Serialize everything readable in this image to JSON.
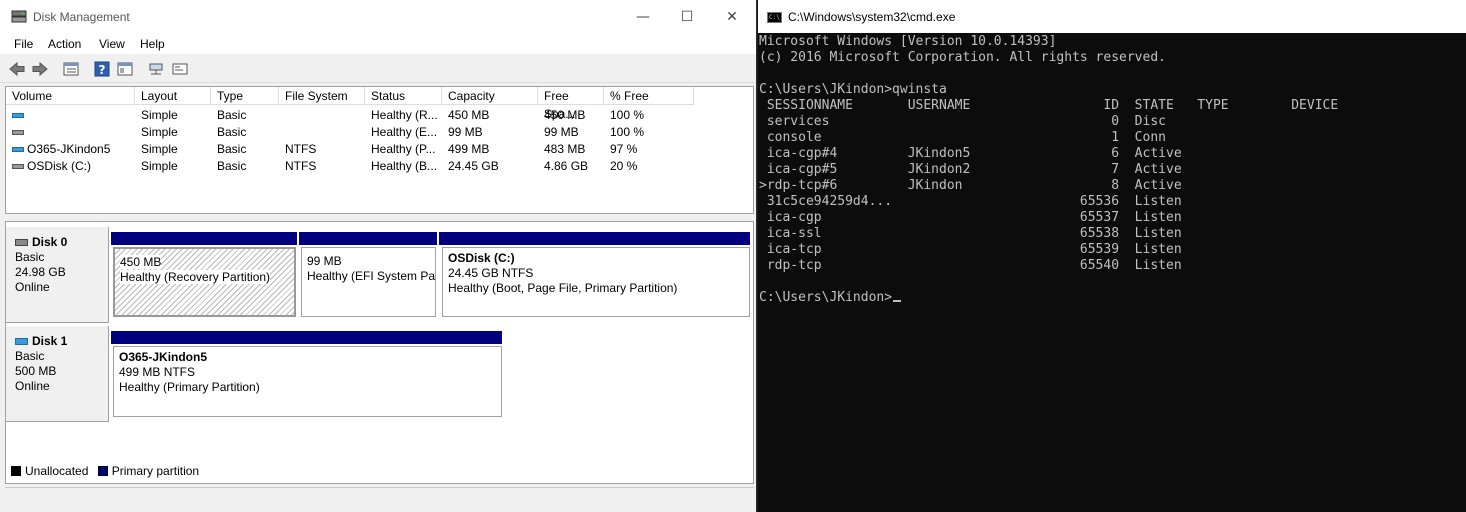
{
  "disk_mgmt": {
    "title": "Disk Management",
    "window_buttons": {
      "minimize": "—",
      "maximize": "☐",
      "close": "✕"
    },
    "menu": [
      "File",
      "Action",
      "View",
      "Help"
    ],
    "toolbar_icons": [
      "back-arrow-icon",
      "forward-arrow-icon",
      "list-view-icon",
      "help-icon",
      "properties-icon",
      "connect-icon",
      "console-icon"
    ],
    "volume_table": {
      "columns": [
        "Volume",
        "Layout",
        "Type",
        "File System",
        "Status",
        "Capacity",
        "Free Spa...",
        "% Free"
      ],
      "rows": [
        {
          "volume": "",
          "layout": "Simple",
          "type": "Basic",
          "fs": "",
          "status": "Healthy (R...",
          "capacity": "450 MB",
          "free": "450 MB",
          "pct": "100 %"
        },
        {
          "volume": "",
          "layout": "Simple",
          "type": "Basic",
          "fs": "",
          "status": "Healthy (E...",
          "capacity": "99 MB",
          "free": "99 MB",
          "pct": "100 %"
        },
        {
          "volume": "O365-JKindon5",
          "layout": "Simple",
          "type": "Basic",
          "fs": "NTFS",
          "status": "Healthy (P...",
          "capacity": "499 MB",
          "free": "483 MB",
          "pct": "97 %"
        },
        {
          "volume": "OSDisk (C:)",
          "layout": "Simple",
          "type": "Basic",
          "fs": "NTFS",
          "status": "Healthy (B...",
          "capacity": "24.45 GB",
          "free": "4.86 GB",
          "pct": "20 %"
        }
      ]
    },
    "disks": [
      {
        "name": "Disk 0",
        "type": "Basic",
        "size": "24.98 GB",
        "state": "Online",
        "partitions": [
          {
            "name": "",
            "size": "450 MB",
            "status": "Healthy (Recovery Partition)"
          },
          {
            "name": "",
            "size": "99 MB",
            "status": "Healthy (EFI System Par"
          },
          {
            "name": "OSDisk  (C:)",
            "size": "24.45 GB NTFS",
            "status": "Healthy (Boot, Page File, Primary Partition)"
          }
        ]
      },
      {
        "name": "Disk 1",
        "type": "Basic",
        "size": "500 MB",
        "state": "Online",
        "partitions": [
          {
            "name": "O365-JKindon5",
            "size": "499 MB NTFS",
            "status": "Healthy (Primary Partition)"
          }
        ]
      }
    ],
    "legend": [
      "Unallocated",
      "Primary partition"
    ],
    "colors": {
      "primary_partition": "#000080",
      "unallocated": "#000000"
    }
  },
  "cmd": {
    "title": "C:\\Windows\\system32\\cmd.exe",
    "lines": [
      "Microsoft Windows [Version 10.0.14393]",
      "(c) 2016 Microsoft Corporation. All rights reserved.",
      "",
      "C:\\Users\\JKindon>qwinsta",
      " SESSIONNAME       USERNAME                 ID  STATE   TYPE        DEVICE",
      " services                                    0  Disc",
      " console                                     1  Conn",
      " ica-cgp#4         JKindon5                  6  Active",
      " ica-cgp#5         JKindon2                  7  Active",
      ">rdp-tcp#6         JKindon                   8  Active",
      " 31c5ce94259d4...                        65536  Listen",
      " ica-cgp                                 65537  Listen",
      " ica-ssl                                 65538  Listen",
      " ica-tcp                                 65539  Listen",
      " rdp-tcp                                 65540  Listen",
      ""
    ],
    "prompt": "C:\\Users\\JKindon>"
  }
}
